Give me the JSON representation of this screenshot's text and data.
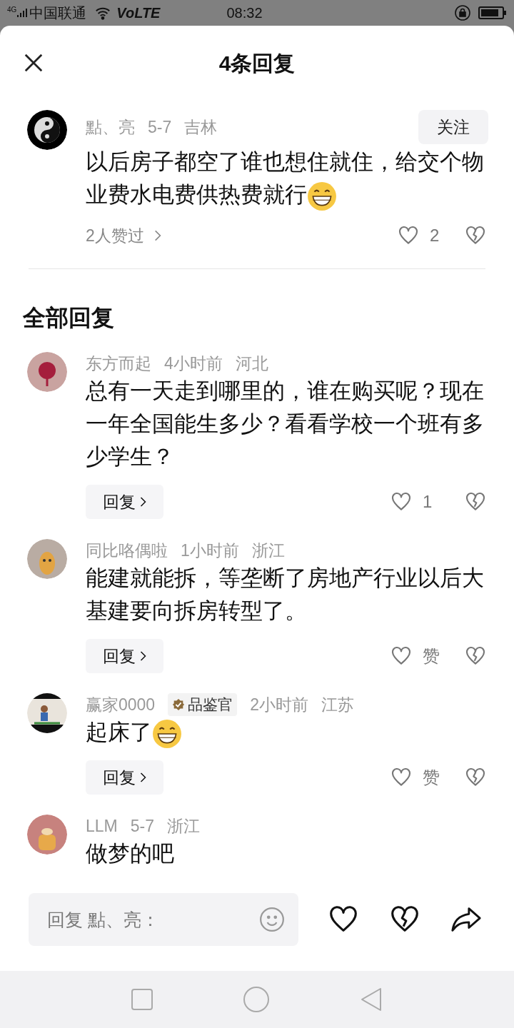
{
  "status_bar": {
    "network": "4G",
    "carrier": "中国联通",
    "volte": "VoLTE",
    "time": "08:32"
  },
  "header": {
    "title": "4条回复"
  },
  "main_comment": {
    "author": "點、亮",
    "date": "5-7",
    "location": "吉林",
    "follow": "关注",
    "text": "以后房子都空了谁也想住就住，给交个物业费水电费供热费就行",
    "has_emoji": true,
    "likers": "2人赞过",
    "likes": "2"
  },
  "section_title": "全部回复",
  "replies": [
    {
      "author": "东方而起",
      "time": "4小时前",
      "location": "河北",
      "text": "总有一天走到哪里的，谁在购买呢？现在一年全国能生多少？看看学校一个班有多少学生？",
      "reply": "回复",
      "likes": "1"
    },
    {
      "author": "同比咯偶啦",
      "time": "1小时前",
      "location": "浙江",
      "text": "能建就能拆，等垄断了房地产行业以后大基建要向拆房转型了。",
      "reply": "回复",
      "likes": "赞"
    },
    {
      "author": "赢家0000",
      "badge": "品鉴官",
      "time": "2小时前",
      "location": "江苏",
      "text": "起床了",
      "has_emoji": true,
      "reply": "回复",
      "likes": "赞"
    },
    {
      "author": "LLM",
      "time": "5-7",
      "location": "浙江",
      "text": "做梦的吧"
    }
  ],
  "input": {
    "placeholder": "回复 點、亮："
  }
}
